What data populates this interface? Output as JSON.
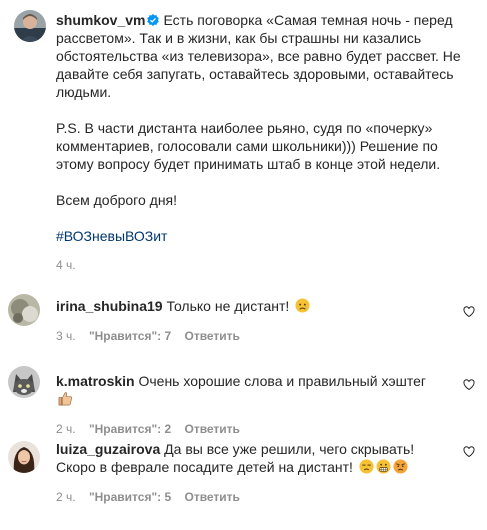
{
  "post": {
    "username": "shumkov_vm",
    "paragraph1": "Есть поговорка «Самая темная ночь - перед рассветом». Так и в жизни, как бы страшны ни казались обстоятельства «из телевизора», все равно будет рассвет. Не давайте себя запугать, оставайтесь здоровыми, оставайтесь людьми.",
    "paragraph2": "P.S. В части дистанта наиболее рьяно, судя по «почерку» комментариев, голосовали сами школьники))) Решение по этому вопросу будет принимать штаб в конце этой недели.",
    "paragraph3": "Всем доброго дня!",
    "hashtag": "#ВОЗневыВОЗит",
    "time": "4 ч."
  },
  "comments": [
    {
      "username": "irina_shubina19",
      "text": "Только не дистант!",
      "emojis": [
        "sad-face"
      ],
      "time": "3 ч.",
      "likes": "\"Нравится\": 7",
      "reply": "Ответить"
    },
    {
      "username": "k.matroskin",
      "text": "Очень хорошие слова и правильный хэштег",
      "emojis": [
        "thumbs-up"
      ],
      "time": "2 ч.",
      "likes": "\"Нравится\": 2",
      "reply": "Ответить"
    },
    {
      "username": "luiza_guzairova",
      "text": "Да вы все уже решили, чего скрывать! Скоро в феврале посадите детей на дистант!",
      "emojis": [
        "unamused-face",
        "grimacing-face",
        "angry-face"
      ],
      "time": "2 ч.",
      "likes": "\"Нравится\": 5",
      "reply": "Ответить"
    }
  ],
  "colors": {
    "text": "#262626",
    "meta": "#8e8e8e",
    "hashtag": "#00376b",
    "verified": "#0095f6"
  }
}
